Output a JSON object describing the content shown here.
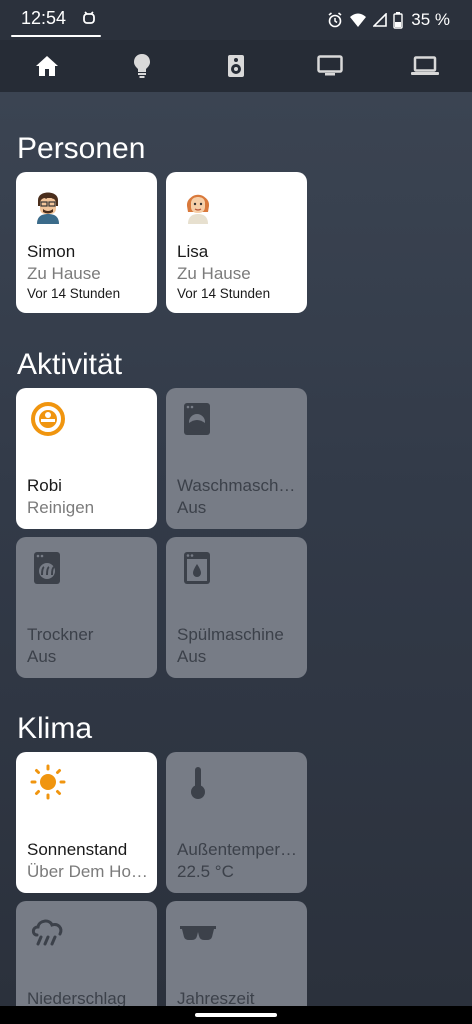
{
  "status": {
    "time": "12:54",
    "battery_text": "35 %"
  },
  "nav": {
    "tabs": [
      {
        "icon": "home-icon",
        "active": true
      },
      {
        "icon": "lightbulb-icon",
        "active": false
      },
      {
        "icon": "speaker-icon",
        "active": false
      },
      {
        "icon": "monitor-icon",
        "active": false
      },
      {
        "icon": "laptop-icon",
        "active": false
      }
    ]
  },
  "sections": {
    "personen": {
      "title": "Personen",
      "cards": [
        {
          "name": "Simon",
          "state": "Zu Hause",
          "time": "Vor 14 Stunden",
          "icon": "avatar-simon"
        },
        {
          "name": "Lisa",
          "state": "Zu Hause",
          "time": "Vor 14 Stunden",
          "icon": "avatar-lisa"
        }
      ]
    },
    "aktivitaet": {
      "title": "Aktivität",
      "cards": [
        {
          "name": "Robi",
          "state": "Reinigen",
          "icon": "robot-vacuum-icon"
        },
        {
          "name": "Waschmaschine",
          "state": "Aus",
          "icon": "washing-machine-icon"
        },
        {
          "name": "Trockner",
          "state": "Aus",
          "icon": "dryer-icon"
        },
        {
          "name": "Spülmaschine",
          "state": "Aus",
          "icon": "dishwasher-icon"
        }
      ]
    },
    "klima": {
      "title": "Klima",
      "cards": [
        {
          "name": "Sonnenstand",
          "state": "Über Dem Horizont",
          "icon": "sun-icon"
        },
        {
          "name": "Außentemperatur",
          "state": "22.5 °C",
          "icon": "thermometer-icon"
        },
        {
          "name": "Niederschlag",
          "state": "",
          "icon": "rain-icon"
        },
        {
          "name": "Jahreszeit",
          "state": "",
          "icon": "sunglasses-icon"
        }
      ]
    }
  },
  "colors": {
    "active_card": "#ffffff",
    "inactive_card": "#777c86",
    "accent_orange": "#f0950f"
  }
}
